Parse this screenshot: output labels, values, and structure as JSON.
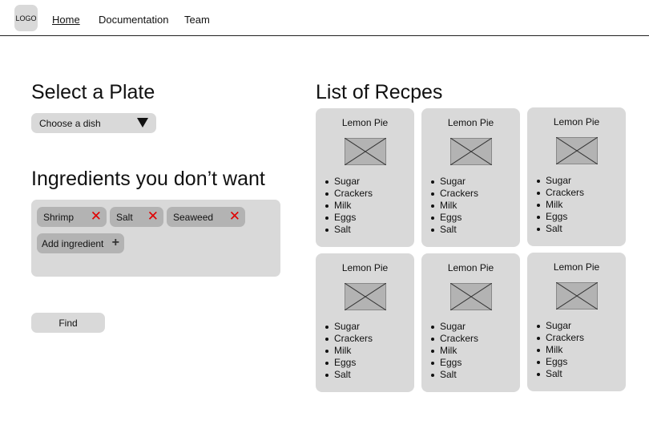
{
  "header": {
    "logo": "LOGO",
    "nav": [
      {
        "label": "Home",
        "active": true
      },
      {
        "label": "Documentation",
        "active": false
      },
      {
        "label": "Team",
        "active": false
      }
    ]
  },
  "plate": {
    "title": "Select a Plate",
    "select_value": "Choose a dish"
  },
  "ingredients": {
    "title": "Ingredients you don’t want",
    "chips": [
      "Shrimp",
      "Salt",
      "Seaweed"
    ],
    "add_label": "Add ingredient"
  },
  "find_label": "Find",
  "recipes": {
    "title": "List of Recpes",
    "cards": [
      {
        "title": "Lemon Pie",
        "ingredients": [
          "Sugar",
          "Crackers",
          "Milk",
          "Eggs",
          "Salt"
        ]
      },
      {
        "title": "Lemon Pie",
        "ingredients": [
          "Sugar",
          "Crackers",
          "Milk",
          "Eggs",
          "Salt"
        ]
      },
      {
        "title": "Lemon Pie",
        "ingredients": [
          "Sugar",
          "Crackers",
          "Milk",
          "Eggs",
          "Salt"
        ]
      },
      {
        "title": "Lemon Pie",
        "ingredients": [
          "Sugar",
          "Crackers",
          "Milk",
          "Eggs",
          "Salt"
        ]
      },
      {
        "title": "Lemon Pie",
        "ingredients": [
          "Sugar",
          "Crackers",
          "Milk",
          "Eggs",
          "Salt"
        ]
      },
      {
        "title": "Lemon Pie",
        "ingredients": [
          "Sugar",
          "Crackers",
          "Milk",
          "Eggs",
          "Salt"
        ]
      }
    ]
  },
  "icons": {
    "remove": "close-icon",
    "add": "plus-icon",
    "dropdown": "triangle-down-icon",
    "image": "image-placeholder-icon"
  },
  "colors": {
    "panel": "#d9d9d9",
    "chip": "#b3b3b3",
    "remove": "#e00000"
  }
}
